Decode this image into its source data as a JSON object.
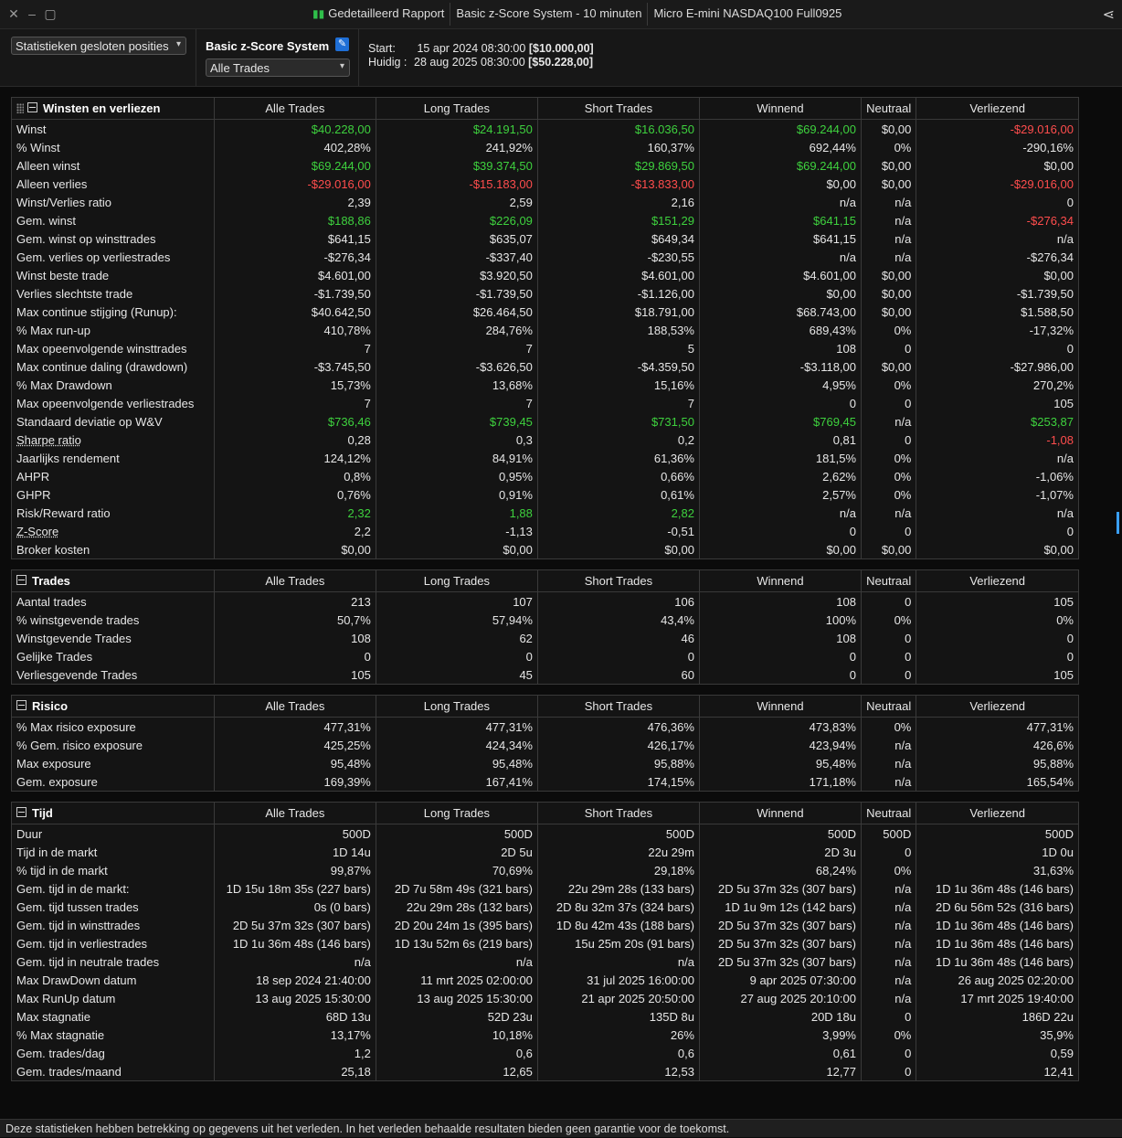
{
  "window": {
    "tabs": [
      {
        "label": "Gedetailleerd Rapport",
        "icon": "chart-icon"
      },
      {
        "label": "Basic z-Score System - 10 minuten"
      },
      {
        "label": "Micro E-mini NASDAQ100 Full0925"
      }
    ]
  },
  "header": {
    "stats_dropdown": "Statistieken gesloten posities",
    "system_name": "Basic z-Score System",
    "trades_dropdown": "Alle Trades",
    "start_label": "Start:",
    "start_value": "15 apr 2024 08:30:00",
    "start_capital": "[$10.000,00]",
    "current_label": "Huidig :",
    "current_value": "28 aug 2025 08:30:00",
    "current_capital": "[$50.228,00]"
  },
  "columns": [
    "Alle Trades",
    "Long Trades",
    "Short Trades",
    "Winnend",
    "Neutraal",
    "Verliezend"
  ],
  "colors": {
    "positive": "#3ed13e",
    "negative": "#ff4d4d"
  },
  "sections": [
    {
      "title": "Winsten en verliezen",
      "rows": [
        {
          "label": "Winst",
          "values": [
            "$40.228,00",
            "$24.191,50",
            "$16.036,50",
            "$69.244,00",
            "$0,00",
            "-$29.016,00"
          ],
          "colors": [
            "g",
            "g",
            "g",
            "g",
            "",
            "r"
          ]
        },
        {
          "label": "% Winst",
          "values": [
            "402,28%",
            "241,92%",
            "160,37%",
            "692,44%",
            "0%",
            "-290,16%"
          ]
        },
        {
          "label": "Alleen winst",
          "values": [
            "$69.244,00",
            "$39.374,50",
            "$29.869,50",
            "$69.244,00",
            "$0,00",
            "$0,00"
          ],
          "colors": [
            "g",
            "g",
            "g",
            "g",
            "",
            ""
          ]
        },
        {
          "label": "Alleen verlies",
          "values": [
            "-$29.016,00",
            "-$15.183,00",
            "-$13.833,00",
            "$0,00",
            "$0,00",
            "-$29.016,00"
          ],
          "colors": [
            "r",
            "r",
            "r",
            "",
            "",
            "r"
          ]
        },
        {
          "label": "Winst/Verlies ratio",
          "values": [
            "2,39",
            "2,59",
            "2,16",
            "n/a",
            "n/a",
            "0"
          ]
        },
        {
          "label": "Gem. winst",
          "values": [
            "$188,86",
            "$226,09",
            "$151,29",
            "$641,15",
            "n/a",
            "-$276,34"
          ],
          "colors": [
            "g",
            "g",
            "g",
            "g",
            "",
            "r"
          ]
        },
        {
          "label": "Gem. winst op winsttrades",
          "values": [
            "$641,15",
            "$635,07",
            "$649,34",
            "$641,15",
            "n/a",
            "n/a"
          ]
        },
        {
          "label": "Gem. verlies op verliestrades",
          "values": [
            "-$276,34",
            "-$337,40",
            "-$230,55",
            "n/a",
            "n/a",
            "-$276,34"
          ]
        },
        {
          "label": "Winst beste trade",
          "values": [
            "$4.601,00",
            "$3.920,50",
            "$4.601,00",
            "$4.601,00",
            "$0,00",
            "$0,00"
          ]
        },
        {
          "label": "Verlies slechtste trade",
          "values": [
            "-$1.739,50",
            "-$1.739,50",
            "-$1.126,00",
            "$0,00",
            "$0,00",
            "-$1.739,50"
          ]
        },
        {
          "label": "Max continue stijging (Runup):",
          "values": [
            "$40.642,50",
            "$26.464,50",
            "$18.791,00",
            "$68.743,00",
            "$0,00",
            "$1.588,50"
          ]
        },
        {
          "label": "% Max run-up",
          "values": [
            "410,78%",
            "284,76%",
            "188,53%",
            "689,43%",
            "0%",
            "-17,32%"
          ]
        },
        {
          "label": "Max opeenvolgende winsttrades",
          "values": [
            "7",
            "7",
            "5",
            "108",
            "0",
            "0"
          ]
        },
        {
          "label": "Max continue daling (drawdown)",
          "values": [
            "-$3.745,50",
            "-$3.626,50",
            "-$4.359,50",
            "-$3.118,00",
            "$0,00",
            "-$27.986,00"
          ]
        },
        {
          "label": "% Max Drawdown",
          "values": [
            "15,73%",
            "13,68%",
            "15,16%",
            "4,95%",
            "0%",
            "270,2%"
          ]
        },
        {
          "label": "Max opeenvolgende verliestrades",
          "values": [
            "7",
            "7",
            "7",
            "0",
            "0",
            "105"
          ]
        },
        {
          "label": "Standaard deviatie op W&V",
          "values": [
            "$736,46",
            "$739,45",
            "$731,50",
            "$769,45",
            "n/a",
            "$253,87"
          ],
          "colors": [
            "g",
            "g",
            "g",
            "g",
            "",
            "g"
          ]
        },
        {
          "label": "Sharpe ratio",
          "underline": true,
          "values": [
            "0,28",
            "0,3",
            "0,2",
            "0,81",
            "0",
            "-1,08"
          ],
          "colors": [
            "",
            "",
            "",
            "",
            "",
            "r"
          ]
        },
        {
          "label": "Jaarlijks rendement",
          "values": [
            "124,12%",
            "84,91%",
            "61,36%",
            "181,5%",
            "0%",
            "n/a"
          ]
        },
        {
          "label": "AHPR",
          "values": [
            "0,8%",
            "0,95%",
            "0,66%",
            "2,62%",
            "0%",
            "-1,06%"
          ]
        },
        {
          "label": "GHPR",
          "values": [
            "0,76%",
            "0,91%",
            "0,61%",
            "2,57%",
            "0%",
            "-1,07%"
          ]
        },
        {
          "label": "Risk/Reward ratio",
          "values": [
            "2,32",
            "1,88",
            "2,82",
            "n/a",
            "n/a",
            "n/a"
          ],
          "colors": [
            "g",
            "g",
            "g",
            "",
            "",
            ""
          ]
        },
        {
          "label": "Z-Score",
          "underline": true,
          "values": [
            "2,2",
            "-1,13",
            "-0,51",
            "0",
            "0",
            "0"
          ]
        },
        {
          "label": "Broker kosten",
          "values": [
            "$0,00",
            "$0,00",
            "$0,00",
            "$0,00",
            "$0,00",
            "$0,00"
          ]
        }
      ]
    },
    {
      "title": "Trades",
      "rows": [
        {
          "label": "Aantal trades",
          "values": [
            "213",
            "107",
            "106",
            "108",
            "0",
            "105"
          ]
        },
        {
          "label": "% winstgevende trades",
          "values": [
            "50,7%",
            "57,94%",
            "43,4%",
            "100%",
            "0%",
            "0%"
          ]
        },
        {
          "label": "Winstgevende Trades",
          "values": [
            "108",
            "62",
            "46",
            "108",
            "0",
            "0"
          ]
        },
        {
          "label": "Gelijke Trades",
          "values": [
            "0",
            "0",
            "0",
            "0",
            "0",
            "0"
          ]
        },
        {
          "label": "Verliesgevende Trades",
          "values": [
            "105",
            "45",
            "60",
            "0",
            "0",
            "105"
          ]
        }
      ]
    },
    {
      "title": "Risico",
      "rows": [
        {
          "label": "% Max risico exposure",
          "values": [
            "477,31%",
            "477,31%",
            "476,36%",
            "473,83%",
            "0%",
            "477,31%"
          ]
        },
        {
          "label": "% Gem. risico exposure",
          "values": [
            "425,25%",
            "424,34%",
            "426,17%",
            "423,94%",
            "n/a",
            "426,6%"
          ]
        },
        {
          "label": "Max exposure",
          "values": [
            "95,48%",
            "95,48%",
            "95,88%",
            "95,48%",
            "n/a",
            "95,88%"
          ]
        },
        {
          "label": "Gem. exposure",
          "values": [
            "169,39%",
            "167,41%",
            "174,15%",
            "171,18%",
            "n/a",
            "165,54%"
          ]
        }
      ]
    },
    {
      "title": "Tijd",
      "rows": [
        {
          "label": "Duur",
          "values": [
            "500D",
            "500D",
            "500D",
            "500D",
            "500D",
            "500D"
          ]
        },
        {
          "label": "Tijd in de markt",
          "values": [
            "1D 14u",
            "2D 5u",
            "22u 29m",
            "2D 3u",
            "0",
            "1D 0u"
          ]
        },
        {
          "label": "% tijd in de markt",
          "values": [
            "99,87%",
            "70,69%",
            "29,18%",
            "68,24%",
            "0%",
            "31,63%"
          ]
        },
        {
          "label": "Gem. tijd in de markt:",
          "values": [
            "1D 15u 18m 35s (227 bars)",
            "2D 7u 58m 49s (321 bars)",
            "22u 29m 28s (133 bars)",
            "2D 5u 37m 32s (307 bars)",
            "n/a",
            "1D 1u 36m 48s (146 bars)"
          ]
        },
        {
          "label": "Gem. tijd tussen trades",
          "values": [
            "0s (0 bars)",
            "22u 29m 28s (132 bars)",
            "2D 8u 32m 37s (324 bars)",
            "1D 1u 9m 12s (142 bars)",
            "n/a",
            "2D 6u 56m 52s (316 bars)"
          ]
        },
        {
          "label": "Gem. tijd in winsttrades",
          "values": [
            "2D 5u 37m 32s (307 bars)",
            "2D 20u 24m 1s (395 bars)",
            "1D 8u 42m 43s (188 bars)",
            "2D 5u 37m 32s (307 bars)",
            "n/a",
            "1D 1u 36m 48s (146 bars)"
          ]
        },
        {
          "label": "Gem. tijd in verliestrades",
          "values": [
            "1D 1u 36m 48s (146 bars)",
            "1D 13u 52m 6s (219 bars)",
            "15u 25m 20s (91 bars)",
            "2D 5u 37m 32s (307 bars)",
            "n/a",
            "1D 1u 36m 48s (146 bars)"
          ]
        },
        {
          "label": "Gem. tijd in neutrale trades",
          "values": [
            "n/a",
            "n/a",
            "n/a",
            "2D 5u 37m 32s (307 bars)",
            "n/a",
            "1D 1u 36m 48s (146 bars)"
          ]
        },
        {
          "label": "Max DrawDown datum",
          "values": [
            "18 sep 2024 21:40:00",
            "11 mrt 2025 02:00:00",
            "31 jul 2025 16:00:00",
            "9 apr 2025 07:30:00",
            "n/a",
            "26 aug 2025 02:20:00"
          ]
        },
        {
          "label": "Max RunUp datum",
          "values": [
            "13 aug 2025 15:30:00",
            "13 aug 2025 15:30:00",
            "21 apr 2025 20:50:00",
            "27 aug 2025 20:10:00",
            "n/a",
            "17 mrt 2025 19:40:00"
          ]
        },
        {
          "label": "Max stagnatie",
          "values": [
            "68D 13u",
            "52D 23u",
            "135D 8u",
            "20D 18u",
            "0",
            "186D 22u"
          ]
        },
        {
          "label": "% Max stagnatie",
          "values": [
            "13,17%",
            "10,18%",
            "26%",
            "3,99%",
            "0%",
            "35,9%"
          ]
        },
        {
          "label": "Gem. trades/dag",
          "values": [
            "1,2",
            "0,6",
            "0,6",
            "0,61",
            "0",
            "0,59"
          ]
        },
        {
          "label": "Gem. trades/maand",
          "values": [
            "25,18",
            "12,65",
            "12,53",
            "12,77",
            "0",
            "12,41"
          ]
        }
      ]
    }
  ],
  "footer": "Deze statistieken hebben betrekking op gegevens uit het verleden. In het verleden behaalde resultaten bieden geen garantie voor de toekomst."
}
